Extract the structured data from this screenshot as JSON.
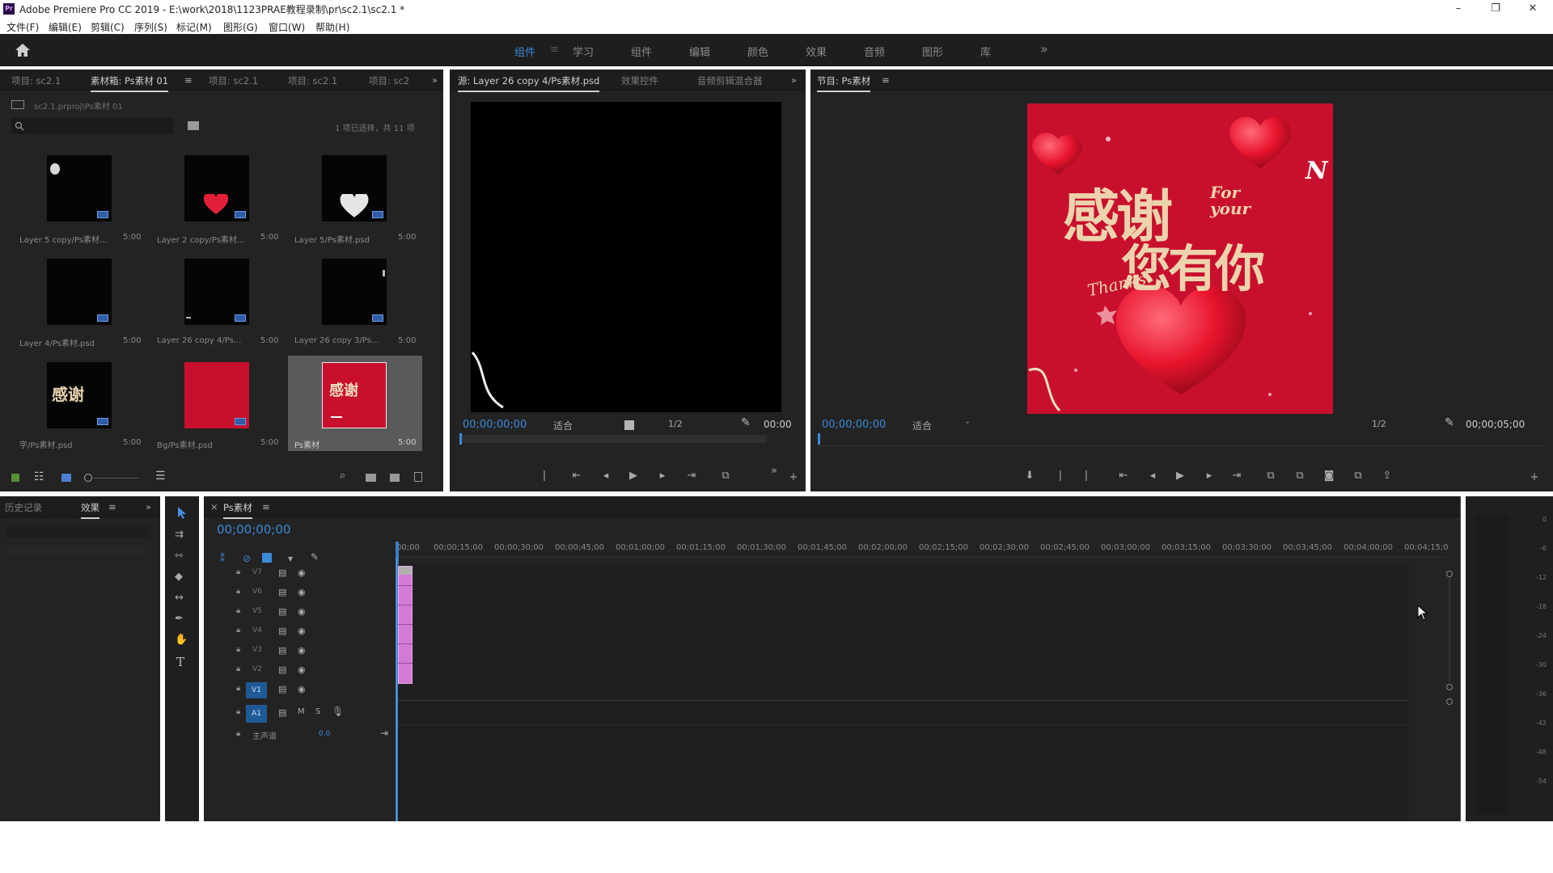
{
  "window": {
    "app_icon": "Pr",
    "title": "Adobe Premiere Pro CC 2019 - E:\\work\\2018\\1123PRAE教程录制\\pr\\sc2.1\\sc2.1 *",
    "minimize": "–",
    "restore": "❐",
    "close": "✕"
  },
  "menu": [
    "文件(F)",
    "编辑(E)",
    "剪辑(C)",
    "序列(S)",
    "标记(M)",
    "图形(G)",
    "窗口(W)",
    "帮助(H)"
  ],
  "workspaces": {
    "tabs": [
      "组件",
      "学习",
      "组件",
      "编辑",
      "颜色",
      "效果",
      "音频",
      "图形",
      "库"
    ],
    "active_index": 0,
    "more": "»"
  },
  "project_panel": {
    "tabs": [
      "项目: sc2.1",
      "素材箱: Ps素材 01",
      "项目: sc2.1",
      "项目: sc2.1",
      "项目: sc2"
    ],
    "active_index": 1,
    "more": "»",
    "path": "sc2.1.prproj\\Ps素材 01",
    "search_placeholder": "",
    "item_count": "1 项已选择，共 11 项",
    "items": [
      {
        "label": "Layer 5 copy/Ps素材...",
        "duration": "5:00"
      },
      {
        "label": "Layer 2 copy/Ps素材...",
        "duration": "5:00"
      },
      {
        "label": "Layer 5/Ps素材.psd",
        "duration": "5:00"
      },
      {
        "label": "Layer 4/Ps素材.psd",
        "duration": "5:00"
      },
      {
        "label": "Layer 26 copy 4/Ps...",
        "duration": "5:00"
      },
      {
        "label": "Layer 26 copy 3/Ps...",
        "duration": "5:00"
      },
      {
        "label": "字/Ps素材.psd",
        "duration": "5:00"
      },
      {
        "label": "Bg/Ps素材.psd",
        "duration": "5:00"
      },
      {
        "label": "Ps素材",
        "duration": "5:00"
      }
    ]
  },
  "source_monitor": {
    "tabs": [
      "源: Layer 26 copy 4/Ps素材.psd",
      "效果控件",
      "音频剪辑混合器"
    ],
    "active_index": 0,
    "more": "»",
    "timecode": "00;00;00;00",
    "fit": "适合",
    "resolution": "1/2",
    "duration": "00:00"
  },
  "program_monitor": {
    "tab": "节目: Ps素材",
    "timecode": "00;00;00;00",
    "fit": "适合",
    "resolution": "1/2",
    "duration": "00;00;05;00",
    "artwork": {
      "bg_color": "#c8102e",
      "main_text": "感谢",
      "main_text_2": "您有你",
      "for_your": "For your",
      "thanks": "Thanks",
      "corner_letter": "N"
    }
  },
  "history_panel": {
    "tabs": [
      "历史记录",
      "效果"
    ],
    "active_index": 1,
    "more": "»"
  },
  "timeline": {
    "tab": "Ps素材",
    "timecode": "00;00;00;00",
    "ruler": [
      "00;00",
      "00;00;15;00",
      "00;00;30;00",
      "00;00;45;00",
      "00;01;00;00",
      "00;01;15;00",
      "00;01;30;00",
      "00;01;45;00",
      "00;02;00;00",
      "00;02;15;00",
      "00;02;30;00",
      "00;02;45;00",
      "00;03;00;00",
      "00;03;15;00",
      "00;03;30;00",
      "00;03;45;00",
      "00;04;00;00",
      "00;04;15;0"
    ],
    "video_tracks": [
      "V7",
      "V6",
      "V5",
      "V4",
      "V3",
      "V2",
      "V1"
    ],
    "audio_tracks": [
      "A1"
    ],
    "master": "主声道",
    "master_value": "0.0",
    "mute": "M",
    "solo": "S",
    "clip_color": "#d27ad6"
  },
  "tools": [
    "selection-tool",
    "track-select-tool",
    "ripple-edit-tool",
    "razor-tool",
    "slip-tool",
    "pen-tool",
    "hand-tool",
    "type-tool"
  ],
  "type_tool_glyph": "T",
  "meter_labels": [
    "0",
    "-6",
    "-12",
    "-18",
    "-24",
    "-30",
    "-36",
    "-42",
    "-48",
    "-54"
  ],
  "colors": {
    "accent_blue": "#3b8ad9",
    "panel_bg": "#232323",
    "dark_bg": "#1d1d1d"
  }
}
